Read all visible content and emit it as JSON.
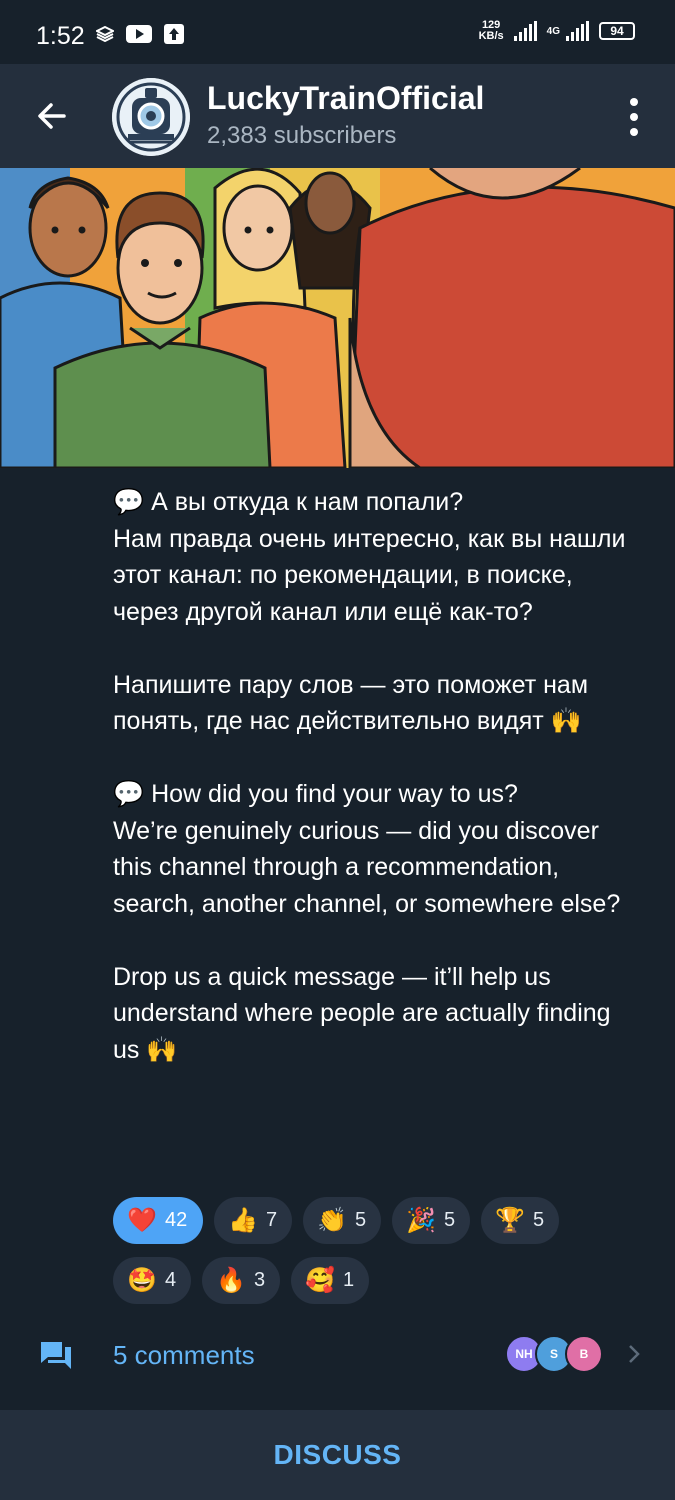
{
  "status_bar": {
    "time": "1:52",
    "speed_value": "129",
    "speed_unit": "KB/s",
    "network": "4G",
    "battery": "94",
    "icons": [
      "layers-icon",
      "youtube-icon",
      "upload-icon",
      "signal-icon",
      "battery-icon"
    ]
  },
  "header": {
    "title": "LuckyTrainOfficial",
    "subtitle": "2,383 subscribers"
  },
  "post": {
    "ru_line1": " А вы откуда к нам попали?",
    "ru_body": "Нам правда очень интересно, как вы нашли этот канал: по рекомендации, в поиске, через другой канал или ещё как-то?",
    "ru_para2": "Напишите пару слов — это поможет нам понять, где нас действительно видят",
    "en_line1": " How did you find your way to us?",
    "en_body": "We’re genuinely curious — did you discover this channel through a recommendation, search, another channel, or somewhere else?",
    "en_para2": "Drop us a quick message — it’ll help us understand where people are actually finding us",
    "speech_emoji": "💬",
    "hands_emoji": "🙌"
  },
  "reactions": [
    {
      "emoji": "❤️",
      "count": "42",
      "active": true
    },
    {
      "emoji": "👍",
      "count": "7"
    },
    {
      "emoji": "👏",
      "count": "5"
    },
    {
      "emoji": "🎉",
      "count": "5"
    },
    {
      "emoji": "🏆",
      "count": "5"
    },
    {
      "emoji": "🤩",
      "count": "4"
    },
    {
      "emoji": "🔥",
      "count": "3"
    },
    {
      "emoji": "🥰",
      "count": "1"
    }
  ],
  "comments": {
    "label": "5 comments",
    "avatars": [
      {
        "initials": "NH",
        "color": "#8e7cf0"
      },
      {
        "initials": "S",
        "color": "#4f9fdc"
      },
      {
        "initials": "B",
        "color": "#e06fa6"
      }
    ]
  },
  "discuss": {
    "label": "DISCUSS"
  }
}
